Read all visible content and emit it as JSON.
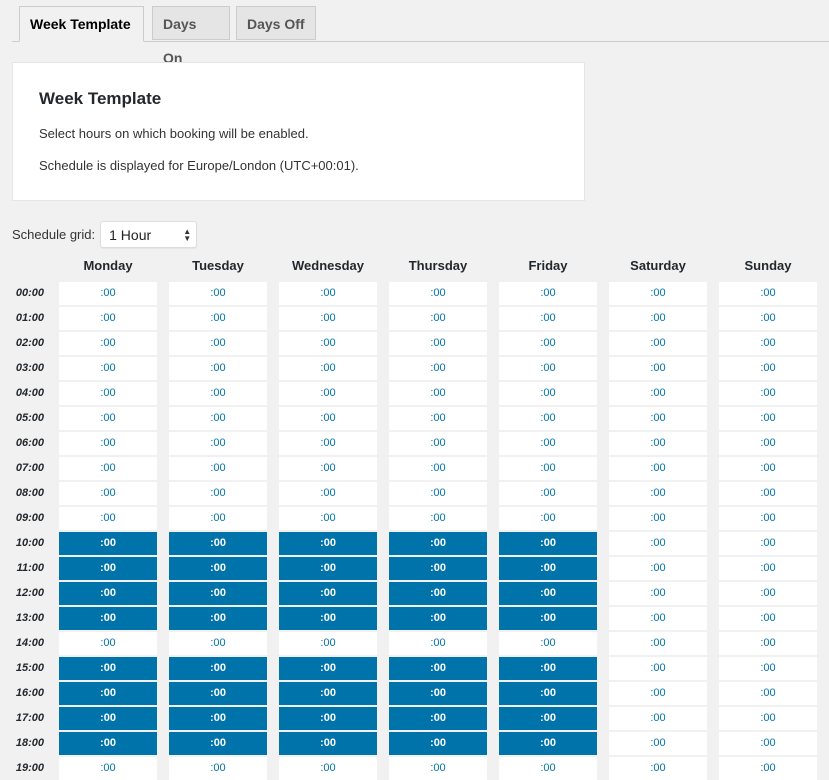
{
  "tabs": [
    {
      "label": "Week Template",
      "active": true
    },
    {
      "label": "Days On",
      "active": false
    },
    {
      "label": "Days Off",
      "active": false
    }
  ],
  "card": {
    "title": "Week Template",
    "line1": "Select hours on which booking will be enabled.",
    "line2": "Schedule is displayed for Europe/London (UTC+00:01)."
  },
  "schedule_grid": {
    "label": "Schedule grid:",
    "value": "1 Hour"
  },
  "days": [
    "Monday",
    "Tuesday",
    "Wednesday",
    "Thursday",
    "Friday",
    "Saturday",
    "Sunday"
  ],
  "hours": [
    "00:00",
    "01:00",
    "02:00",
    "03:00",
    "04:00",
    "05:00",
    "06:00",
    "07:00",
    "08:00",
    "09:00",
    "10:00",
    "11:00",
    "12:00",
    "13:00",
    "14:00",
    "15:00",
    "16:00",
    "17:00",
    "18:00",
    "19:00"
  ],
  "cell_label": ":00",
  "selected_hours": {
    "Monday": [
      "10:00",
      "11:00",
      "12:00",
      "13:00",
      "15:00",
      "16:00",
      "17:00",
      "18:00"
    ],
    "Tuesday": [
      "10:00",
      "11:00",
      "12:00",
      "13:00",
      "15:00",
      "16:00",
      "17:00",
      "18:00"
    ],
    "Wednesday": [
      "10:00",
      "11:00",
      "12:00",
      "13:00",
      "15:00",
      "16:00",
      "17:00",
      "18:00"
    ],
    "Thursday": [
      "10:00",
      "11:00",
      "12:00",
      "13:00",
      "15:00",
      "16:00",
      "17:00",
      "18:00"
    ],
    "Friday": [
      "10:00",
      "11:00",
      "12:00",
      "13:00",
      "15:00",
      "16:00",
      "17:00",
      "18:00"
    ],
    "Saturday": [],
    "Sunday": []
  },
  "colors": {
    "selected": "#0073aa",
    "link": "#0073aa"
  }
}
